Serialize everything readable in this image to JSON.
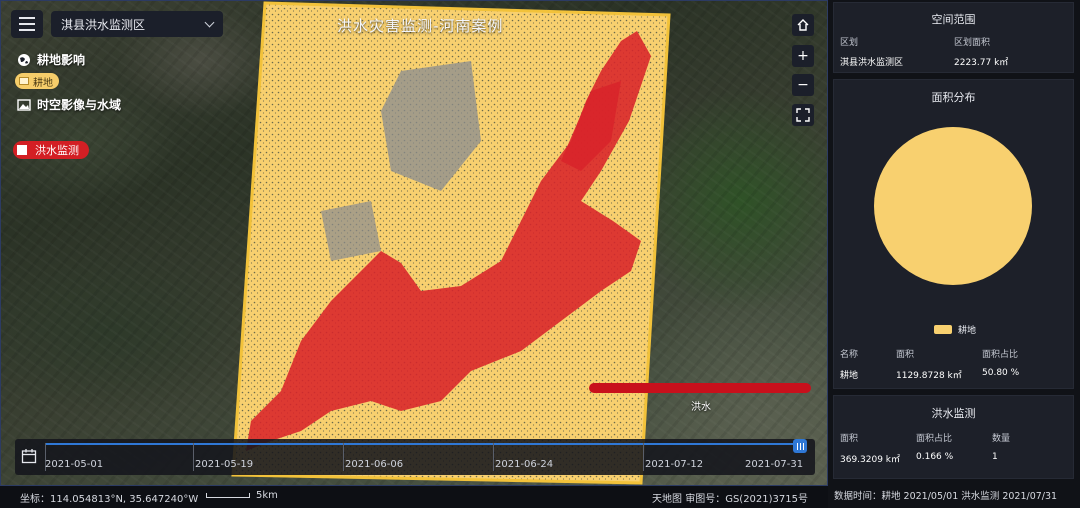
{
  "map": {
    "title": "洪水灾害监测-河南案例",
    "region_select": "淇县洪水监测区",
    "layers": {
      "farmland_group": "耕地影响",
      "farmland_chip": "耕地",
      "imagery_group": "时空影像与水域",
      "flood_chip": "洪水监测"
    },
    "legend_label": "洪水",
    "controls": {
      "zoom_in": "+",
      "zoom_out": "−"
    }
  },
  "timeline": {
    "dates": [
      "2021-05-01",
      "2021-05-19",
      "2021-06-06",
      "2021-06-24",
      "2021-07-12",
      "2021-07-31"
    ]
  },
  "status": {
    "coordinate": "坐标：114.054813°N, 35.647240°W",
    "scale_label": "5km",
    "credit": "天地图 审图号：GS(2021)3715号"
  },
  "panel_extent": {
    "title": "空间范围",
    "col1_header": "区划",
    "col2_header": "区划面积",
    "col1_value": "淇县洪水监测区",
    "col2_value": "2223.77 k㎡"
  },
  "panel_area": {
    "title": "面积分布",
    "legend": "耕地",
    "headers": [
      "名称",
      "面积",
      "面积占比"
    ],
    "row": [
      "耕地",
      "1129.8728 k㎡",
      "50.80 %"
    ]
  },
  "chart_data": {
    "type": "pie",
    "title": "",
    "categories": [
      "耕地"
    ],
    "values": [
      1129.8728
    ],
    "colors": [
      "#f8d06f"
    ]
  },
  "panel_flood": {
    "title": "洪水监测",
    "headers": [
      "面积",
      "面积占比",
      "数量"
    ],
    "row": [
      "369.3209 k㎡",
      "0.166 %",
      "1"
    ]
  },
  "footer": {
    "data_time": "数据时间：耕地 2021/05/01 洪水监测 2021/07/31"
  },
  "colors": {
    "farmland": "#f8d06f",
    "flood": "#d8232a",
    "accent": "#2f78d6"
  }
}
